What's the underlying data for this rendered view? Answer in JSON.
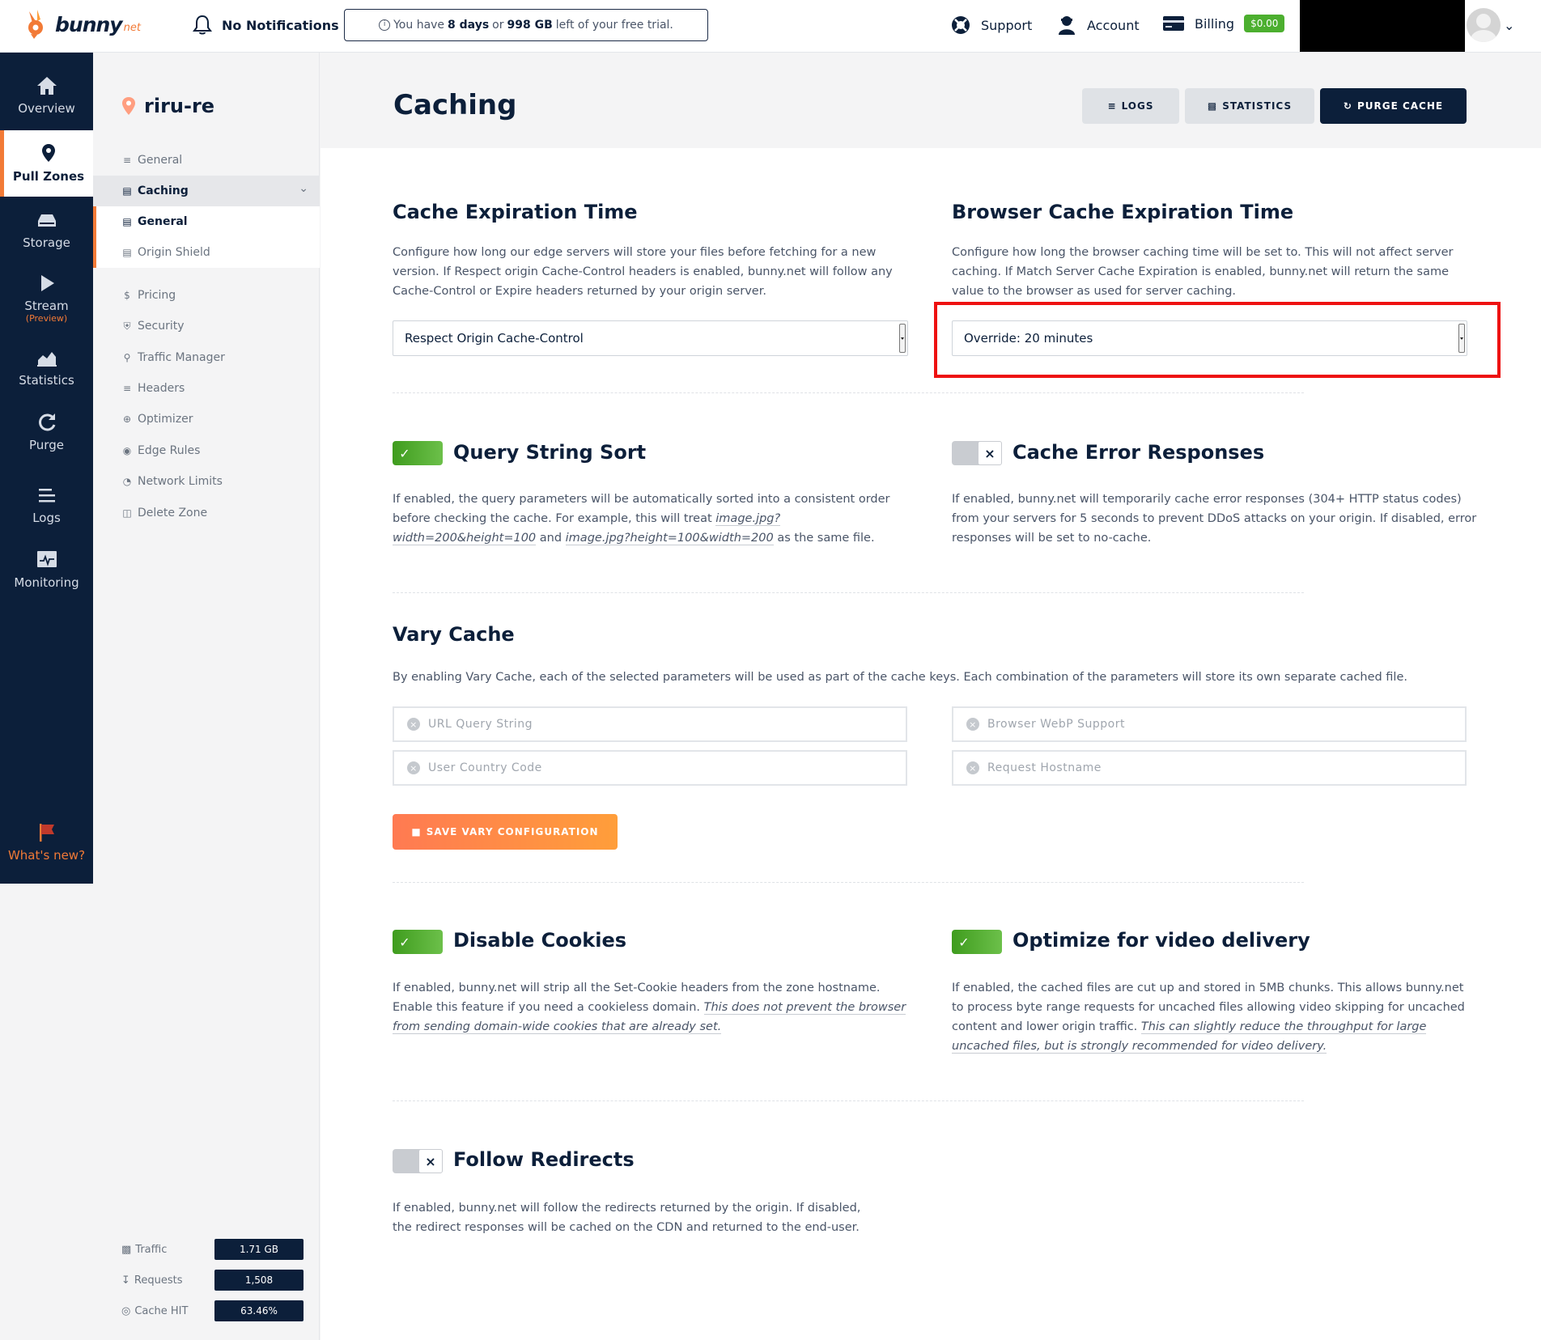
{
  "topbar": {
    "logo_text": "bunny",
    "logo_sub": "net",
    "notifications": "No Notifications",
    "trial_prefix": "You have",
    "trial_days": "8 days",
    "trial_or": "or",
    "trial_gb": "998 GB",
    "trial_suffix": "left of your free trial.",
    "support": "Support",
    "account": "Account",
    "billing": "Billing",
    "billing_amount": "$0.00"
  },
  "leftnav": {
    "overview": "Overview",
    "pull_zones": "Pull Zones",
    "storage": "Storage",
    "stream": "Stream",
    "stream_preview": "(Preview)",
    "statistics": "Statistics",
    "purge": "Purge",
    "logs": "Logs",
    "monitoring": "Monitoring",
    "whats_new": "What's new?"
  },
  "subnav": {
    "zone_name": "riru-re",
    "general": "General",
    "caching": "Caching",
    "caching_general": "General",
    "origin_shield": "Origin Shield",
    "pricing": "Pricing",
    "security": "Security",
    "traffic_manager": "Traffic Manager",
    "headers": "Headers",
    "optimizer": "Optimizer",
    "edge_rules": "Edge Rules",
    "network_limits": "Network Limits",
    "delete_zone": "Delete Zone",
    "stats": {
      "traffic_label": "Traffic",
      "traffic_value": "1.71 GB",
      "requests_label": "Requests",
      "requests_value": "1,508",
      "cachehit_label": "Cache HIT",
      "cachehit_value": "63.46%"
    }
  },
  "main": {
    "title": "Caching",
    "btn_logs": "LOGS",
    "btn_statistics": "STATISTICS",
    "btn_purge": "PURGE CACHE",
    "cache_exp": {
      "title": "Cache Expiration Time",
      "desc": "Configure how long our edge servers will store your files before fetching for a new version. If Respect origin Cache-Control headers is enabled, bunny.net will follow any Cache-Control or Expire headers returned by your origin server.",
      "value": "Respect Origin Cache-Control"
    },
    "browser_exp": {
      "title": "Browser Cache Expiration Time",
      "desc": "Configure how long the browser caching time will be set to. This will not affect server caching. If Match Server Cache Expiration is enabled, bunny.net will return the same value to the browser as used for server caching.",
      "value": "Override: 20 minutes"
    },
    "query_sort": {
      "title": "Query String Sort",
      "desc_1": "If enabled, the query parameters will be automatically sorted into a consistent order before checking the cache. For example, this will treat",
      "example_1": "image.jpg?width=200&height=100",
      "desc_and": "and",
      "example_2": "image.jpg?height=100&width=200",
      "desc_2": "as the same file.",
      "enabled": true
    },
    "cache_errors": {
      "title": "Cache Error Responses",
      "desc": "If enabled, bunny.net will temporarily cache error responses (304+ HTTP status codes) from your servers for 5 seconds to prevent DDoS attacks on your origin. If disabled, error responses will be set to no-cache.",
      "enabled": false
    },
    "vary": {
      "title": "Vary Cache",
      "desc": "By enabling Vary Cache, each of the selected parameters will be used as part of the cache keys. Each combination of the parameters will store its own separate cached file.",
      "opt_url_query": "URL Query String",
      "opt_webp": "Browser WebP Support",
      "opt_country": "User Country Code",
      "opt_hostname": "Request Hostname",
      "save_button": "SAVE VARY CONFIGURATION"
    },
    "disable_cookies": {
      "title": "Disable Cookies",
      "desc": "If enabled, bunny.net will strip all the Set-Cookie headers from the zone hostname. Enable this feature if you need a cookieless domain.",
      "note": "This does not prevent the browser from sending domain-wide cookies that are already set.",
      "enabled": true
    },
    "video": {
      "title": "Optimize for video delivery",
      "desc": "If enabled, the cached files are cut up and stored in 5MB chunks. This allows bunny.net to process byte range requests for uncached files allowing video skipping for uncached content and lower origin traffic.",
      "note": "This can slightly reduce the throughput for large uncached files, but is strongly recommended for video delivery.",
      "enabled": true
    },
    "redirects": {
      "title": "Follow Redirects",
      "desc": "If enabled, bunny.net will follow the redirects returned by the origin. If disabled, the redirect responses will be cached on the CDN and returned to the end-user.",
      "enabled": false
    }
  },
  "colors": {
    "navy": "#0c1f3a",
    "accent_orange": "#f27a36",
    "toggle_green": "#4caf2f",
    "highlight_red": "#ee1111"
  }
}
